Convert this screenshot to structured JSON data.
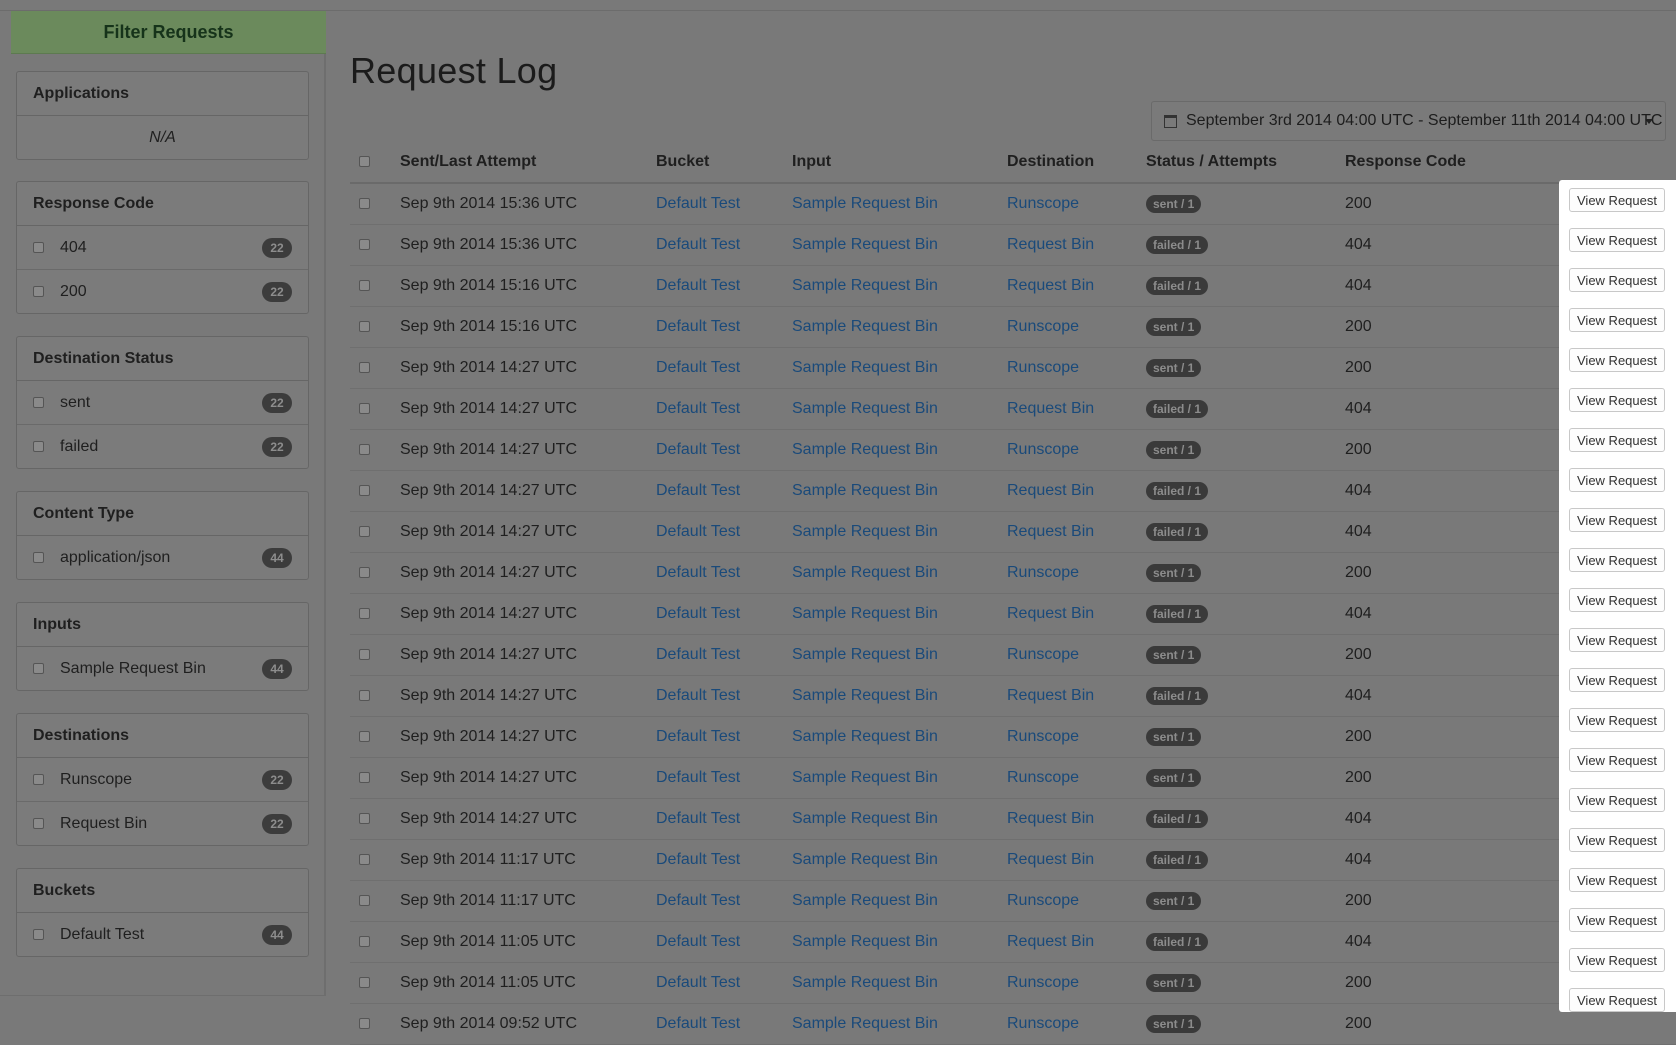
{
  "sidebar": {
    "header": "Filter Requests",
    "panels": [
      {
        "title": "Applications",
        "na": "N/A",
        "items": []
      },
      {
        "title": "Response Code",
        "items": [
          {
            "label": "404",
            "count": "22"
          },
          {
            "label": "200",
            "count": "22"
          }
        ]
      },
      {
        "title": "Destination Status",
        "items": [
          {
            "label": "sent",
            "count": "22"
          },
          {
            "label": "failed",
            "count": "22"
          }
        ]
      },
      {
        "title": "Content Type",
        "items": [
          {
            "label": "application/json",
            "count": "44"
          }
        ]
      },
      {
        "title": "Inputs",
        "items": [
          {
            "label": "Sample Request Bin",
            "count": "44"
          }
        ]
      },
      {
        "title": "Destinations",
        "items": [
          {
            "label": "Runscope",
            "count": "22"
          },
          {
            "label": "Request Bin",
            "count": "22"
          }
        ]
      },
      {
        "title": "Buckets",
        "items": [
          {
            "label": "Default Test",
            "count": "44"
          }
        ]
      }
    ]
  },
  "main": {
    "title": "Request Log",
    "date_range": "September 3rd 2014 04:00 UTC - September 11th 2014 04:00 UTC",
    "view_label": "View Request",
    "columns": [
      "Sent/Last Attempt",
      "Bucket",
      "Input",
      "Destination",
      "Status / Attempts",
      "Response Code"
    ],
    "rows": [
      {
        "time": "Sep 9th 2014 15:36 UTC",
        "bucket": "Default Test",
        "input": "Sample Request Bin",
        "destination": "Runscope",
        "status": "sent / 1",
        "code": "200"
      },
      {
        "time": "Sep 9th 2014 15:36 UTC",
        "bucket": "Default Test",
        "input": "Sample Request Bin",
        "destination": "Request Bin",
        "status": "failed / 1",
        "code": "404"
      },
      {
        "time": "Sep 9th 2014 15:16 UTC",
        "bucket": "Default Test",
        "input": "Sample Request Bin",
        "destination": "Request Bin",
        "status": "failed / 1",
        "code": "404"
      },
      {
        "time": "Sep 9th 2014 15:16 UTC",
        "bucket": "Default Test",
        "input": "Sample Request Bin",
        "destination": "Runscope",
        "status": "sent / 1",
        "code": "200"
      },
      {
        "time": "Sep 9th 2014 14:27 UTC",
        "bucket": "Default Test",
        "input": "Sample Request Bin",
        "destination": "Runscope",
        "status": "sent / 1",
        "code": "200"
      },
      {
        "time": "Sep 9th 2014 14:27 UTC",
        "bucket": "Default Test",
        "input": "Sample Request Bin",
        "destination": "Request Bin",
        "status": "failed / 1",
        "code": "404"
      },
      {
        "time": "Sep 9th 2014 14:27 UTC",
        "bucket": "Default Test",
        "input": "Sample Request Bin",
        "destination": "Runscope",
        "status": "sent / 1",
        "code": "200"
      },
      {
        "time": "Sep 9th 2014 14:27 UTC",
        "bucket": "Default Test",
        "input": "Sample Request Bin",
        "destination": "Request Bin",
        "status": "failed / 1",
        "code": "404"
      },
      {
        "time": "Sep 9th 2014 14:27 UTC",
        "bucket": "Default Test",
        "input": "Sample Request Bin",
        "destination": "Request Bin",
        "status": "failed / 1",
        "code": "404"
      },
      {
        "time": "Sep 9th 2014 14:27 UTC",
        "bucket": "Default Test",
        "input": "Sample Request Bin",
        "destination": "Runscope",
        "status": "sent / 1",
        "code": "200"
      },
      {
        "time": "Sep 9th 2014 14:27 UTC",
        "bucket": "Default Test",
        "input": "Sample Request Bin",
        "destination": "Request Bin",
        "status": "failed / 1",
        "code": "404"
      },
      {
        "time": "Sep 9th 2014 14:27 UTC",
        "bucket": "Default Test",
        "input": "Sample Request Bin",
        "destination": "Runscope",
        "status": "sent / 1",
        "code": "200"
      },
      {
        "time": "Sep 9th 2014 14:27 UTC",
        "bucket": "Default Test",
        "input": "Sample Request Bin",
        "destination": "Request Bin",
        "status": "failed / 1",
        "code": "404"
      },
      {
        "time": "Sep 9th 2014 14:27 UTC",
        "bucket": "Default Test",
        "input": "Sample Request Bin",
        "destination": "Runscope",
        "status": "sent / 1",
        "code": "200"
      },
      {
        "time": "Sep 9th 2014 14:27 UTC",
        "bucket": "Default Test",
        "input": "Sample Request Bin",
        "destination": "Runscope",
        "status": "sent / 1",
        "code": "200"
      },
      {
        "time": "Sep 9th 2014 14:27 UTC",
        "bucket": "Default Test",
        "input": "Sample Request Bin",
        "destination": "Request Bin",
        "status": "failed / 1",
        "code": "404"
      },
      {
        "time": "Sep 9th 2014 11:17 UTC",
        "bucket": "Default Test",
        "input": "Sample Request Bin",
        "destination": "Request Bin",
        "status": "failed / 1",
        "code": "404"
      },
      {
        "time": "Sep 9th 2014 11:17 UTC",
        "bucket": "Default Test",
        "input": "Sample Request Bin",
        "destination": "Runscope",
        "status": "sent / 1",
        "code": "200"
      },
      {
        "time": "Sep 9th 2014 11:05 UTC",
        "bucket": "Default Test",
        "input": "Sample Request Bin",
        "destination": "Request Bin",
        "status": "failed / 1",
        "code": "404"
      },
      {
        "time": "Sep 9th 2014 11:05 UTC",
        "bucket": "Default Test",
        "input": "Sample Request Bin",
        "destination": "Runscope",
        "status": "sent / 1",
        "code": "200"
      },
      {
        "time": "Sep 9th 2014 09:52 UTC",
        "bucket": "Default Test",
        "input": "Sample Request Bin",
        "destination": "Runscope",
        "status": "sent / 1",
        "code": "200"
      }
    ]
  },
  "colors": {
    "background": "#797979",
    "filter_header": "#6b8a5c",
    "link": "#1a4a7a",
    "badge": "#3a3a3a",
    "action_column": "#ffffff"
  },
  "icons": {
    "date_range": "calendar-icon",
    "dropdown": "caret-down-icon"
  }
}
